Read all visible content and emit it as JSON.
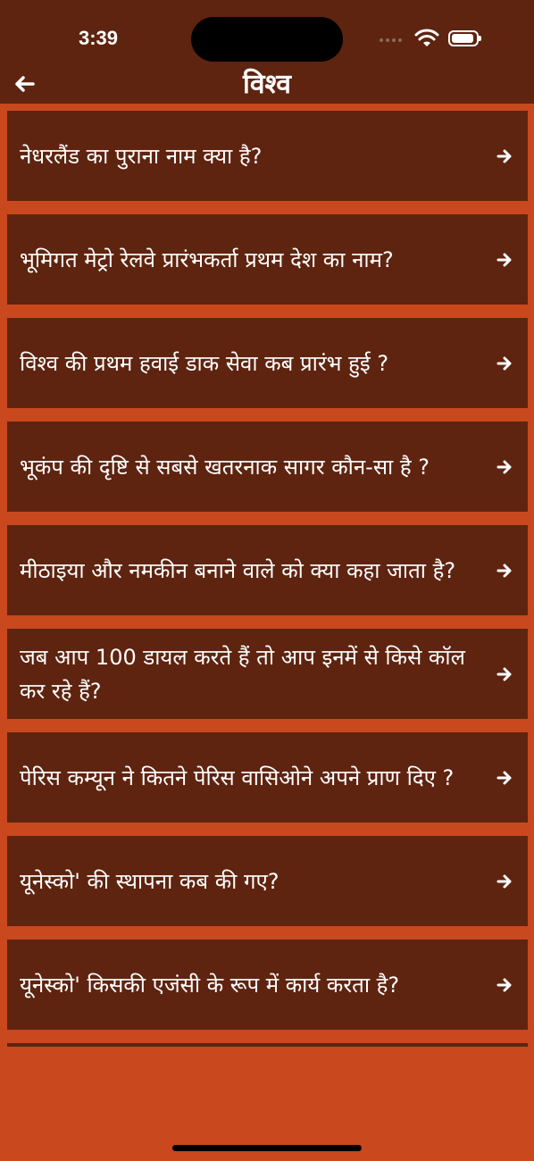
{
  "status": {
    "time": "3:39"
  },
  "header": {
    "title": "विश्व"
  },
  "questions": [
    "नेधरलैंड का पुराना नाम क्या है?",
    "भूमिगत मेट्रो रेलवे प्रारंभकर्ता प्रथम देश का नाम?",
    "विश्व की प्रथम हवाई डाक सेवा कब प्रारंभ हुई ?",
    "भूकंप की दृष्टि से सबसे खतरनाक सागर कौन-सा है ?",
    "मीठाइया और नमकीन बनाने वाले को क्या कहा जाता है?",
    "जब आप 100 डायल करते हैं तो आप इनमें से किसे कॉल कर रहे हैं?",
    "पेरिस कम्यून ने कितने पेरिस वासिओने अपने प्राण दिए ?",
    "यूनेस्को' की स्थापना कब की गए?",
    "यूनेस्को' किसकी एजंसी के रूप में कार्य करता है?"
  ],
  "colors": {
    "primary": "#5e2410",
    "background": "#c9481e",
    "text": "#ffffff"
  }
}
